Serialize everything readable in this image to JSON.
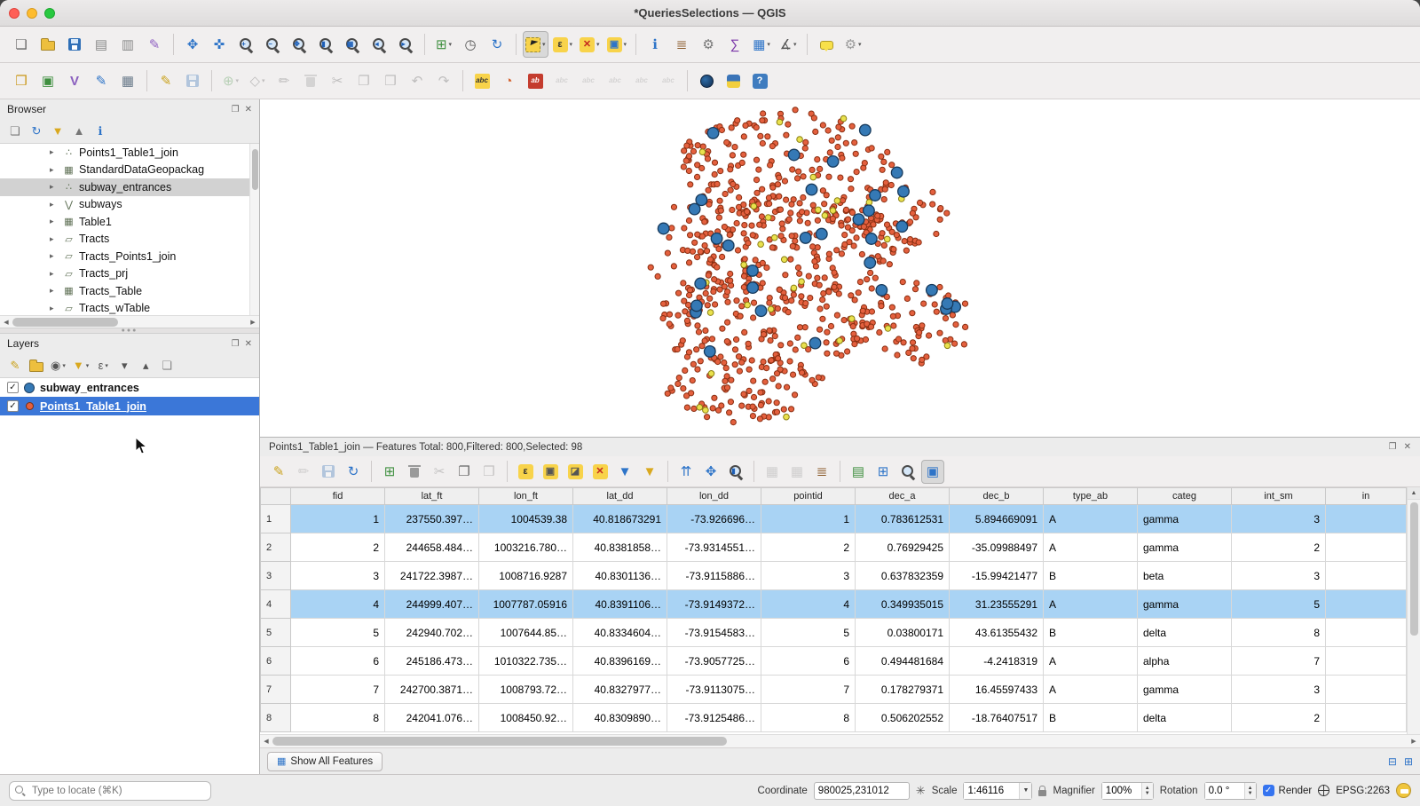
{
  "window": {
    "title": "*QueriesSelections — QGIS"
  },
  "toolbar_main": {
    "items": [
      {
        "name": "project-new",
        "glyph": "❏",
        "fg": "#666"
      },
      {
        "name": "project-open",
        "cls": "folder"
      },
      {
        "name": "project-save",
        "cls": "floppy"
      },
      {
        "name": "new-print-layout",
        "glyph": "▤",
        "fg": "#888"
      },
      {
        "name": "layout-manager",
        "glyph": "▥",
        "fg": "#888"
      },
      {
        "name": "style-manager",
        "glyph": "✎",
        "fg": "#9061c2"
      },
      {
        "sep": true
      },
      {
        "name": "pan-map",
        "glyph": "✥",
        "fg": "#2e74c8"
      },
      {
        "name": "pan-to-selection",
        "glyph": "✜",
        "fg": "#2e74c8"
      },
      {
        "name": "zoom-in",
        "cls": "mag",
        "sub": "+"
      },
      {
        "name": "zoom-out",
        "cls": "mag",
        "sub": "−"
      },
      {
        "name": "zoom-full",
        "cls": "mag",
        "sub": "✥"
      },
      {
        "name": "zoom-to-selection",
        "cls": "mag",
        "sub": "▮"
      },
      {
        "name": "zoom-to-layer",
        "cls": "mag",
        "sub": "▦"
      },
      {
        "name": "zoom-last",
        "cls": "mag",
        "sub": "◂"
      },
      {
        "name": "zoom-next",
        "cls": "mag",
        "sub": "▸"
      },
      {
        "sep": true
      },
      {
        "name": "new-map-view",
        "glyph": "⊞",
        "fg": "#3f8f3f",
        "caret": true
      },
      {
        "name": "temporal-controller",
        "glyph": "◷",
        "fg": "#555"
      },
      {
        "name": "refresh-map",
        "glyph": "↻",
        "fg": "#2e74c8"
      },
      {
        "sep": true
      },
      {
        "name": "select-features",
        "cls": "select",
        "pressed": true,
        "caret": true
      },
      {
        "name": "select-by-expression",
        "glyph": "ε",
        "bg": "#f8d34a",
        "fg": "#333",
        "caret": true
      },
      {
        "name": "deselect-features",
        "glyph": "✕",
        "bg": "#f8d34a",
        "fg": "#c4281e",
        "caret": true
      },
      {
        "name": "select-by-form",
        "glyph": "▣",
        "bg": "#f8d34a",
        "fg": "#2e74c8",
        "caret": true
      },
      {
        "sep": true
      },
      {
        "name": "identify-features",
        "glyph": "ℹ",
        "fg": "#2e74c8"
      },
      {
        "name": "field-calculator",
        "glyph": "≣",
        "fg": "#8a5a2a"
      },
      {
        "name": "processing-toolbox",
        "glyph": "⚙",
        "fg": "#777"
      },
      {
        "name": "statistical-summary",
        "glyph": "∑",
        "fg": "#7a35a8"
      },
      {
        "name": "attribute-table",
        "glyph": "▦",
        "fg": "#2e74c8",
        "caret": true
      },
      {
        "name": "measure",
        "glyph": "∡",
        "fg": "#555",
        "caret": true
      },
      {
        "sep": true
      },
      {
        "name": "map-tips",
        "cls": "bubble"
      },
      {
        "name": "plugin-options",
        "glyph": "⚙",
        "fg": "#999",
        "caret": true
      }
    ]
  },
  "toolbar_edit": {
    "items": [
      {
        "name": "data-source-manager",
        "glyph": "❒",
        "fg": "#c99718"
      },
      {
        "name": "new-geopackage-layer",
        "glyph": "▣",
        "fg": "#3f8f3f"
      },
      {
        "name": "new-shapefile-layer",
        "glyph": "V",
        "fg": "#8a5fbe",
        "bold": true
      },
      {
        "name": "new-spatialite-layer",
        "glyph": "✎",
        "fg": "#2e74c8"
      },
      {
        "name": "new-virtual-layer",
        "glyph": "▦",
        "fg": "#6a7a8a"
      },
      {
        "sep": true
      },
      {
        "name": "toggle-editing",
        "glyph": "✎",
        "fg": "#caa21c"
      },
      {
        "name": "save-edits",
        "cls": "floppy",
        "disabled": true
      },
      {
        "sep": true
      },
      {
        "name": "add-feature",
        "glyph": "⊕",
        "fg": "#3f8f3f",
        "disabled": true,
        "caret": true
      },
      {
        "name": "vertex-tool",
        "glyph": "◇",
        "fg": "#555",
        "disabled": true,
        "caret": true
      },
      {
        "name": "modify-attributes",
        "glyph": "✏",
        "fg": "#555",
        "disabled": true
      },
      {
        "name": "delete-selected",
        "cls": "trash",
        "disabled": true
      },
      {
        "name": "cut-features",
        "glyph": "✂",
        "fg": "#555",
        "disabled": true
      },
      {
        "name": "copy-features",
        "glyph": "❐",
        "fg": "#555",
        "disabled": true
      },
      {
        "name": "paste-features",
        "glyph": "❒",
        "fg": "#555",
        "disabled": true
      },
      {
        "name": "undo",
        "glyph": "↶",
        "fg": "#555",
        "disabled": true
      },
      {
        "name": "redo",
        "glyph": "↷",
        "fg": "#555",
        "disabled": true
      },
      {
        "sep": true
      },
      {
        "name": "layer-labeling",
        "glyph": "abc",
        "small": true,
        "bg": "#f8d34a",
        "fg": "#333"
      },
      {
        "name": "layer-diagram",
        "glyph": "◔",
        "fg": "#d4622f"
      },
      {
        "name": "label-single",
        "glyph": "ab",
        "small": true,
        "bg": "#c43c2e",
        "fg": "#fff"
      },
      {
        "name": "label-pin",
        "glyph": "abc",
        "small": true,
        "fg": "#999",
        "disabled": true
      },
      {
        "name": "label-show-hide",
        "glyph": "abc",
        "small": true,
        "fg": "#999",
        "disabled": true
      },
      {
        "name": "label-move",
        "glyph": "abc",
        "small": true,
        "fg": "#999",
        "disabled": true
      },
      {
        "name": "label-rotate",
        "glyph": "abc",
        "small": true,
        "fg": "#999",
        "disabled": true
      },
      {
        "name": "label-change",
        "glyph": "abc",
        "small": true,
        "fg": "#999",
        "disabled": true
      },
      {
        "sep": true
      },
      {
        "name": "metasearch",
        "cls": "globe"
      },
      {
        "name": "python-console",
        "cls": "python"
      },
      {
        "name": "help",
        "glyph": "?",
        "bg": "#3f7cbf",
        "fg": "#fff",
        "bold": true
      }
    ]
  },
  "browser": {
    "title": "Browser",
    "tools": [
      {
        "name": "add-selected-layers",
        "glyph": "❏",
        "fg": "#777"
      },
      {
        "name": "refresh-browser",
        "glyph": "↻",
        "fg": "#2e74c8"
      },
      {
        "name": "filter-browser",
        "glyph": "▼",
        "fg": "#d9a81e"
      },
      {
        "name": "collapse-all",
        "glyph": "▲",
        "fg": "#777"
      },
      {
        "name": "enable-properties",
        "glyph": "ℹ",
        "fg": "#2e74c8"
      }
    ],
    "items": [
      {
        "label": "Points1_Table1_join",
        "type": "point"
      },
      {
        "label": "StandardDataGeopackag",
        "type": "table"
      },
      {
        "label": "subway_entrances",
        "type": "point",
        "selected": true
      },
      {
        "label": "subways",
        "type": "line"
      },
      {
        "label": "Table1",
        "type": "table"
      },
      {
        "label": "Tracts",
        "type": "polygon"
      },
      {
        "label": "Tracts_Points1_join",
        "type": "polygon"
      },
      {
        "label": "Tracts_prj",
        "type": "polygon"
      },
      {
        "label": "Tracts_Table",
        "type": "table"
      },
      {
        "label": "Tracts_wTable",
        "type": "polygon"
      }
    ]
  },
  "layers": {
    "title": "Layers",
    "tools": [
      {
        "name": "open-layer-styling",
        "glyph": "✎",
        "fg": "#caa21c"
      },
      {
        "name": "add-group",
        "cls": "folder"
      },
      {
        "name": "manage-map-themes",
        "glyph": "◉",
        "fg": "#555",
        "caret": true
      },
      {
        "name": "filter-legend",
        "glyph": "▼",
        "fg": "#d9a81e",
        "caret": true
      },
      {
        "name": "filter-by-expression",
        "glyph": "ε",
        "fg": "#555",
        "caret": true
      },
      {
        "name": "expand-all",
        "glyph": "▾",
        "fg": "#555"
      },
      {
        "name": "collapse-all-layers",
        "glyph": "▴",
        "fg": "#555"
      },
      {
        "name": "remove-layer",
        "glyph": "❏",
        "fg": "#888"
      }
    ],
    "items": [
      {
        "label": "subway_entrances",
        "checked": true,
        "marker": "circle-blue"
      },
      {
        "label": "Points1_Table1_join",
        "checked": true,
        "marker": "dot-red",
        "selected": true
      }
    ]
  },
  "map": {
    "seed": 42,
    "orange": {
      "fill": "#e4603e",
      "stroke": "#8a2f12",
      "r": 3.1
    },
    "yellow": {
      "fill": "#e9e14e",
      "stroke": "#8a7f12",
      "r": 3.3,
      "count": 34
    },
    "blue": {
      "fill": "#3579b5",
      "stroke": "#173a5c",
      "r": 6.3,
      "count": 33
    },
    "clusters": [
      {
        "cx": 0.455,
        "cy": 0.2,
        "rx": 0.095,
        "ry": 0.17,
        "n": 170
      },
      {
        "cx": 0.462,
        "cy": 0.44,
        "rx": 0.1,
        "ry": 0.16,
        "n": 180
      },
      {
        "cx": 0.435,
        "cy": 0.66,
        "rx": 0.092,
        "ry": 0.15,
        "n": 150
      },
      {
        "cx": 0.42,
        "cy": 0.86,
        "rx": 0.07,
        "ry": 0.1,
        "n": 80
      },
      {
        "cx": 0.56,
        "cy": 0.66,
        "rx": 0.055,
        "ry": 0.13,
        "n": 70
      },
      {
        "cx": 0.545,
        "cy": 0.34,
        "rx": 0.048,
        "ry": 0.1,
        "n": 50
      },
      {
        "cx": 0.38,
        "cy": 0.5,
        "rx": 0.045,
        "ry": 0.22,
        "n": 60
      }
    ]
  },
  "attribute_table": {
    "title": "Points1_Table1_join — Features Total: 800,Filtered: 800,Selected: 98",
    "toolbar": [
      {
        "name": "toggle-editing",
        "glyph": "✎",
        "fg": "#caa21c"
      },
      {
        "name": "multi-edit",
        "glyph": "✏",
        "fg": "#888",
        "disabled": true
      },
      {
        "name": "save-edits",
        "cls": "floppy",
        "disabled": true
      },
      {
        "name": "reload-table",
        "glyph": "↻",
        "fg": "#2e74c8"
      },
      {
        "sep": true
      },
      {
        "name": "add-feature",
        "glyph": "⊞",
        "fg": "#3f8f3f"
      },
      {
        "name": "delete-selected-features",
        "cls": "trash"
      },
      {
        "name": "cut-row",
        "glyph": "✂",
        "fg": "#666",
        "disabled": true
      },
      {
        "name": "copy-selected-rows",
        "glyph": "❐",
        "fg": "#666"
      },
      {
        "name": "paste-features",
        "glyph": "❒",
        "fg": "#666",
        "disabled": true
      },
      {
        "sep": true
      },
      {
        "name": "select-by-expression",
        "glyph": "ε",
        "bg": "#f8d34a",
        "fg": "#333"
      },
      {
        "name": "select-all",
        "glyph": "▣",
        "bg": "#f8d34a",
        "fg": "#555"
      },
      {
        "name": "invert-selection",
        "glyph": "◪",
        "bg": "#f8d34a",
        "fg": "#555"
      },
      {
        "name": "deselect-all",
        "glyph": "✕",
        "bg": "#f8d34a",
        "fg": "#c4281e"
      },
      {
        "name": "filter-select-by-form",
        "glyph": "▼",
        "fg": "#2e74c8"
      },
      {
        "name": "filter-features",
        "glyph": "▼",
        "fg": "#d9a81e"
      },
      {
        "sep": true
      },
      {
        "name": "move-selection-to-top",
        "glyph": "⇈",
        "fg": "#2e74c8"
      },
      {
        "name": "pan-to-selection",
        "glyph": "✥",
        "fg": "#2e74c8"
      },
      {
        "name": "zoom-to-selection",
        "cls": "mag",
        "sub": "▮"
      },
      {
        "sep": true
      },
      {
        "name": "new-field",
        "glyph": "▦",
        "fg": "#888",
        "disabled": true
      },
      {
        "name": "delete-field",
        "glyph": "▦",
        "fg": "#888",
        "disabled": true
      },
      {
        "name": "open-field-calculator",
        "glyph": "≣",
        "fg": "#8a5a2a"
      },
      {
        "sep": true
      },
      {
        "name": "conditional-formatting",
        "glyph": "▤",
        "fg": "#3f8f3f"
      },
      {
        "name": "dock-attribute-table",
        "glyph": "⊞",
        "fg": "#2e74c8"
      },
      {
        "name": "search-widget",
        "cls": "mag"
      },
      {
        "name": "attribute-table-view",
        "glyph": "▣",
        "fg": "#2e74c8",
        "pressed": true
      }
    ],
    "columns": [
      "fid",
      "lat_ft",
      "lon_ft",
      "lat_dd",
      "lon_dd",
      "pointid",
      "dec_a",
      "dec_b",
      "type_ab",
      "categ",
      "int_sm",
      "in"
    ],
    "rows": [
      {
        "selected": true,
        "cells": [
          "1",
          "237550.397…",
          "1004539.38",
          "40.818673291",
          "-73.926696…",
          "1",
          "0.783612531",
          "5.894669091",
          "A",
          "gamma",
          "3",
          ""
        ]
      },
      {
        "selected": false,
        "cells": [
          "2",
          "244658.484…",
          "1003216.780…",
          "40.8381858…",
          "-73.9314551…",
          "2",
          "0.76929425",
          "-35.09988497",
          "A",
          "gamma",
          "2",
          ""
        ]
      },
      {
        "selected": false,
        "cells": [
          "3",
          "241722.3987…",
          "1008716.9287",
          "40.8301136…",
          "-73.9115886…",
          "3",
          "0.637832359",
          "-15.99421477",
          "B",
          "beta",
          "3",
          ""
        ]
      },
      {
        "selected": true,
        "cells": [
          "4",
          "244999.407…",
          "1007787.05916",
          "40.8391106…",
          "-73.9149372…",
          "4",
          "0.349935015",
          "31.23555291",
          "A",
          "gamma",
          "5",
          ""
        ]
      },
      {
        "selected": false,
        "cells": [
          "5",
          "242940.702…",
          "1007644.85…",
          "40.8334604…",
          "-73.9154583…",
          "5",
          "0.03800171",
          "43.61355432",
          "B",
          "delta",
          "8",
          ""
        ]
      },
      {
        "selected": false,
        "cells": [
          "6",
          "245186.473…",
          "1010322.735…",
          "40.8396169…",
          "-73.9057725…",
          "6",
          "0.494481684",
          "-4.2418319",
          "A",
          "alpha",
          "7",
          ""
        ]
      },
      {
        "selected": false,
        "cells": [
          "7",
          "242700.3871…",
          "1008793.72…",
          "40.8327977…",
          "-73.9113075…",
          "7",
          "0.178279371",
          "16.45597433",
          "A",
          "gamma",
          "3",
          ""
        ]
      },
      {
        "selected": false,
        "cells": [
          "8",
          "242041.076…",
          "1008450.92…",
          "40.8309890…",
          "-73.9125486…",
          "8",
          "0.506202552",
          "-18.76407517",
          "B",
          "delta",
          "2",
          ""
        ]
      }
    ],
    "footer_button": "Show All Features"
  },
  "statusbar": {
    "locate_placeholder": "Type to locate (⌘K)",
    "coordinate_label": "Coordinate",
    "coordinate_value": "980025,231012",
    "scale_label": "Scale",
    "scale_value": "1:46116",
    "magnifier_label": "Magnifier",
    "magnifier_value": "100%",
    "rotation_label": "Rotation",
    "rotation_value": "0.0 °",
    "render_label": "Render",
    "epsg_label": "EPSG:2263"
  }
}
